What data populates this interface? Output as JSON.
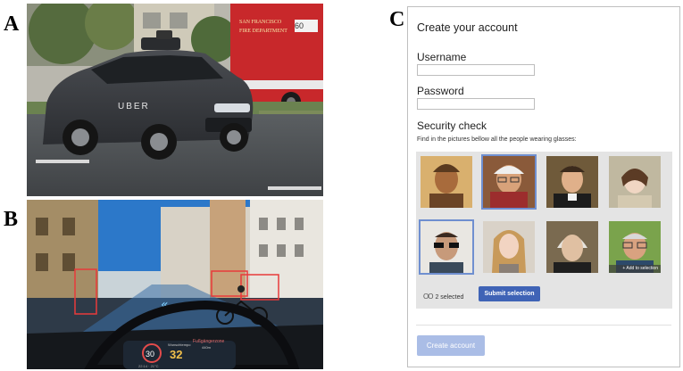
{
  "panel_labels": {
    "a": "A",
    "b": "B",
    "c": "C"
  },
  "panel_a": {
    "vehicle_brand": "UBER",
    "truck_text_line1": "SAN FRANCISCO",
    "truck_text_line2": "FIRE DEPARTMENT",
    "truck_number": "60"
  },
  "panel_b": {
    "speed_left": "30",
    "speed_main": "32",
    "speed_main_label": "Wunschtempo",
    "warning_text": "Fußgängerzone",
    "warning_sub": "440m",
    "bottom_label": "22:14 · 21°C"
  },
  "signup": {
    "title": "Create your account",
    "username_label": "Username",
    "password_label": "Password",
    "security_title": "Security check",
    "security_instruction": "Find in the pictures bellow all the people wearing glasses:",
    "selected_count": "2 selected",
    "selected_icon": "OO",
    "tile_caption": "+ Add to selection",
    "submit_label": "Submit selection",
    "create_label": "Create account"
  },
  "colors": {
    "submit_blue": "#3f63b6",
    "create_disabled": "#aabde6",
    "selection_outline": "#6f8fd0"
  }
}
